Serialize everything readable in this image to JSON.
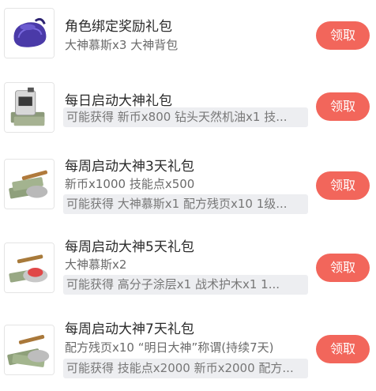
{
  "colors": {
    "button": "#f2665b",
    "chip_bg": "#edeef1",
    "bag": "#4a3aa8"
  },
  "gifts": [
    {
      "title": "角色绑定奖励礼包",
      "desc": "大神慕斯x3 大神背包",
      "chip": "",
      "button": "领取",
      "icon": "purple-backpack-icon"
    },
    {
      "title": "每日启动大神礼包",
      "desc": "",
      "chip": "可能获得 新币x800 钻头天然机油x1 技...",
      "button": "领取",
      "icon": "oil-canister-cash-icon"
    },
    {
      "title": "每周启动大神3天礼包",
      "desc": "新币x1000 技能点x500",
      "chip": "可能获得 大神慕斯x1 配方残页x10 1级...",
      "button": "领取",
      "icon": "cash-and-cigar-icon"
    },
    {
      "title": "每周启动大神5天礼包",
      "desc": "大神慕斯x2",
      "chip": "可能获得 高分子涂层x1 战术护木x1 1...",
      "button": "领取",
      "icon": "cake-and-cigar-icon"
    },
    {
      "title": "每周启动大神7天礼包",
      "desc": "配方残页x10 “明日大神”称谓(持续7天)",
      "chip": "可能获得 技能点x2000 新币x2000 配方...",
      "button": "领取",
      "icon": "cash-and-scroll-icon"
    }
  ]
}
